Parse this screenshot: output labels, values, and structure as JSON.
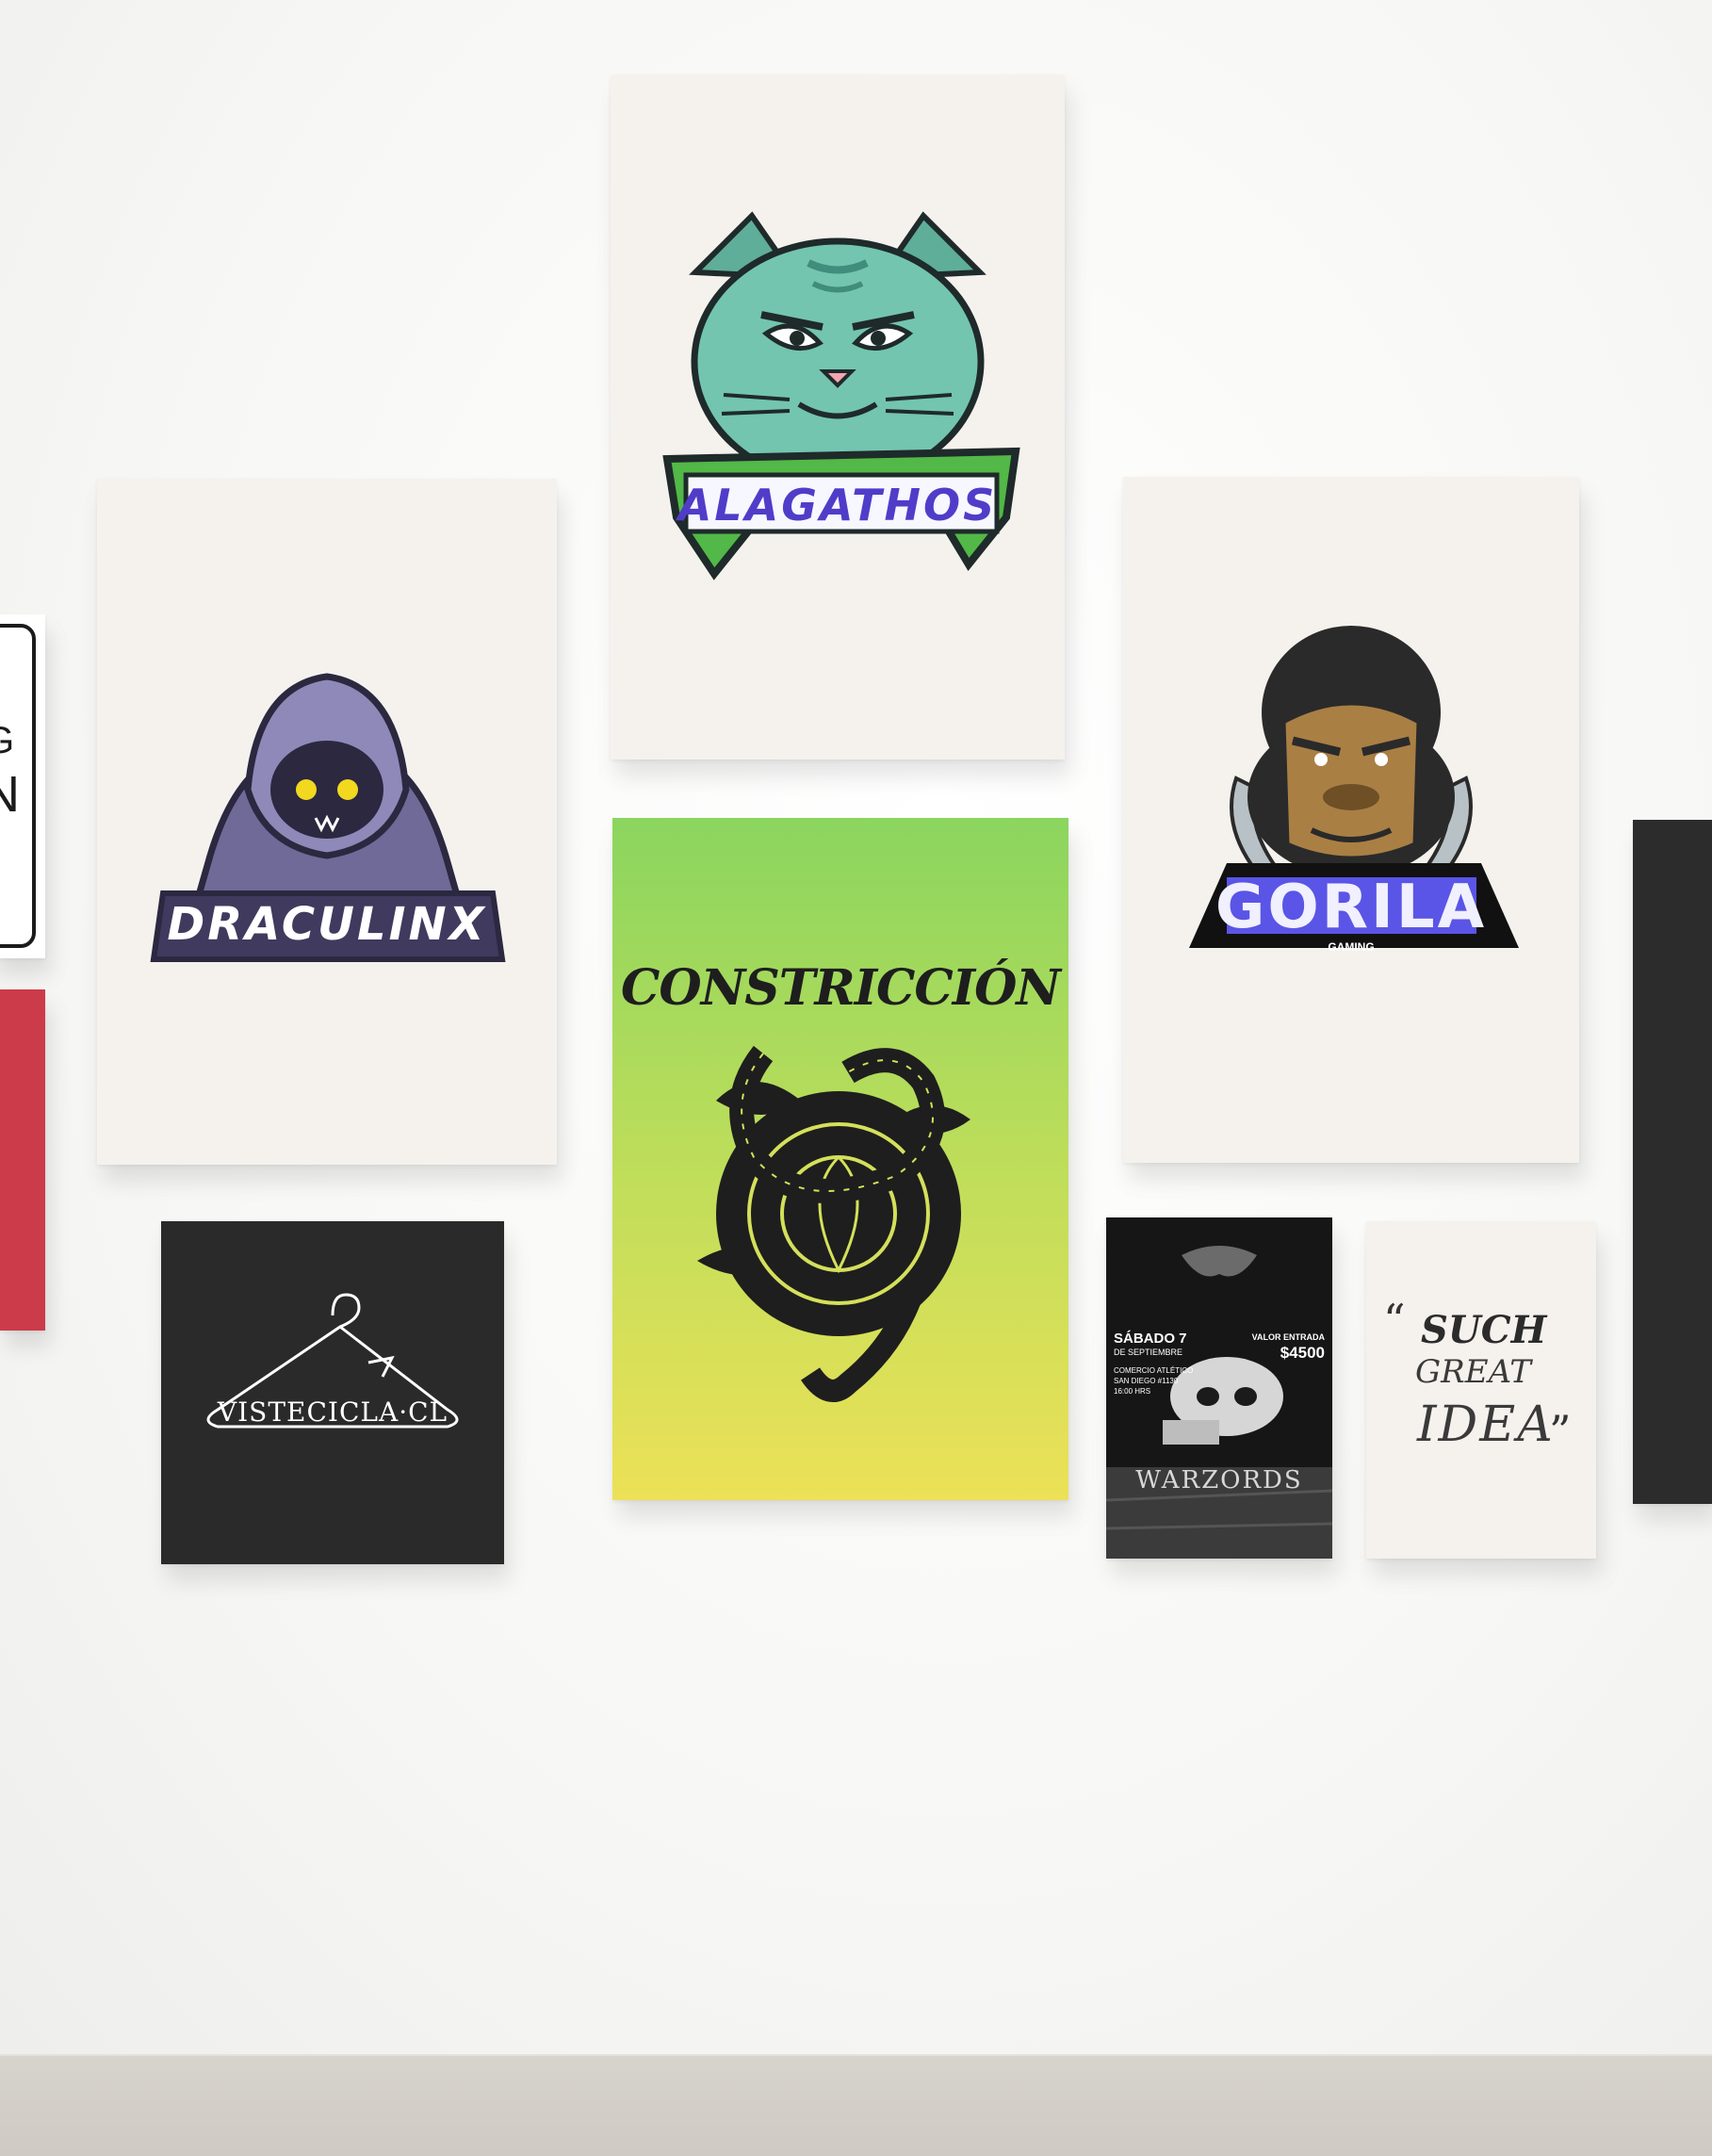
{
  "scene": {
    "wall_color": "#f7f7f5",
    "floor_color": "#d3cfc9"
  },
  "left_sign": {
    "letters": [
      "G",
      "N"
    ],
    "icon": "sign-border-icon"
  },
  "posters": {
    "alagathos": {
      "name": "ALAGATHOS",
      "icon": "cat-head-icon",
      "colors": {
        "face": "#73c5b0",
        "banner": "#52b847",
        "text": "#4f3dc9"
      }
    },
    "draculinx": {
      "name": "DRACULINX",
      "icon": "hooded-figure-icon",
      "colors": {
        "hood": "#6f6a98",
        "eyes": "#f2d81f",
        "banner": "#3f3a5e"
      }
    },
    "constriccion": {
      "name": "CONSTRICCIÓN",
      "icon": "snake-flower-icon",
      "colors": {
        "top": "#8bd55e",
        "bottom": "#ece157"
      }
    },
    "gorila": {
      "name": "GORILA",
      "sub": "GAMING",
      "icon": "gorilla-head-icon",
      "colors": {
        "fur": "#2a2a2a",
        "face": "#a97f44",
        "text": "#3b3be0"
      }
    },
    "vistecicla": {
      "name": "VISTECICLA·CL",
      "icon": "hanger-icon"
    },
    "warlords": {
      "date": "SÁBADO 7",
      "month": "DE SEPTIEMBRE",
      "price_label": "VALOR ENTRADA",
      "price": "$4500",
      "venue": "COMERCIO ATLÉTICO",
      "address": "SAN DIEGO #1130",
      "time": "16:00 HRS",
      "band": "WARZORDS",
      "icon": "skull-icon"
    },
    "such_great_idea": {
      "line1": "SUCH",
      "line2": "GREAT",
      "line3": "IDEA",
      "open_quote": "“",
      "close_quote": "”"
    }
  }
}
